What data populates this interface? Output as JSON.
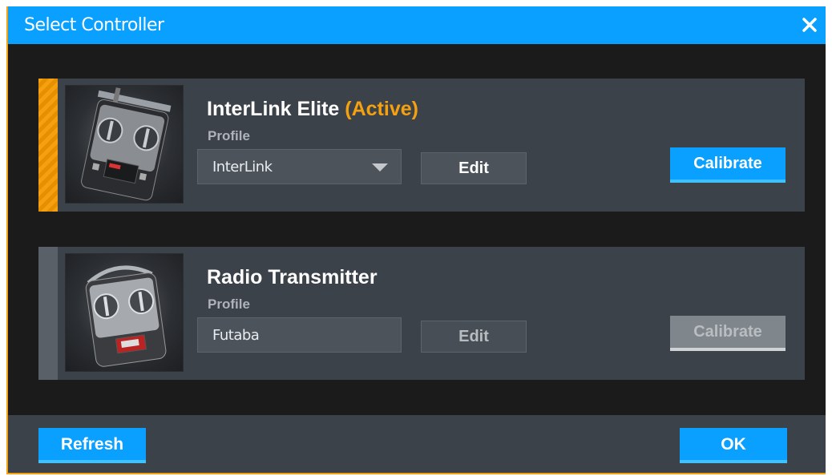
{
  "window": {
    "title": "Select Controller",
    "close_icon": "close-icon"
  },
  "controllers": [
    {
      "name": "InterLink Elite",
      "status": "(Active)",
      "profile_label": "Profile",
      "profile_value": "InterLink",
      "edit_label": "Edit",
      "calibrate_label": "Calibrate",
      "active": true
    },
    {
      "name": "Radio Transmitter",
      "status": "",
      "profile_label": "Profile",
      "profile_value": "Futaba",
      "edit_label": "Edit",
      "calibrate_label": "Calibrate",
      "active": false
    }
  ],
  "footer": {
    "refresh_label": "Refresh",
    "ok_label": "OK"
  },
  "colors": {
    "accent": "#0aa0ff",
    "active": "#f5a10f",
    "card": "#3c424a",
    "background": "#1b1b1b"
  }
}
